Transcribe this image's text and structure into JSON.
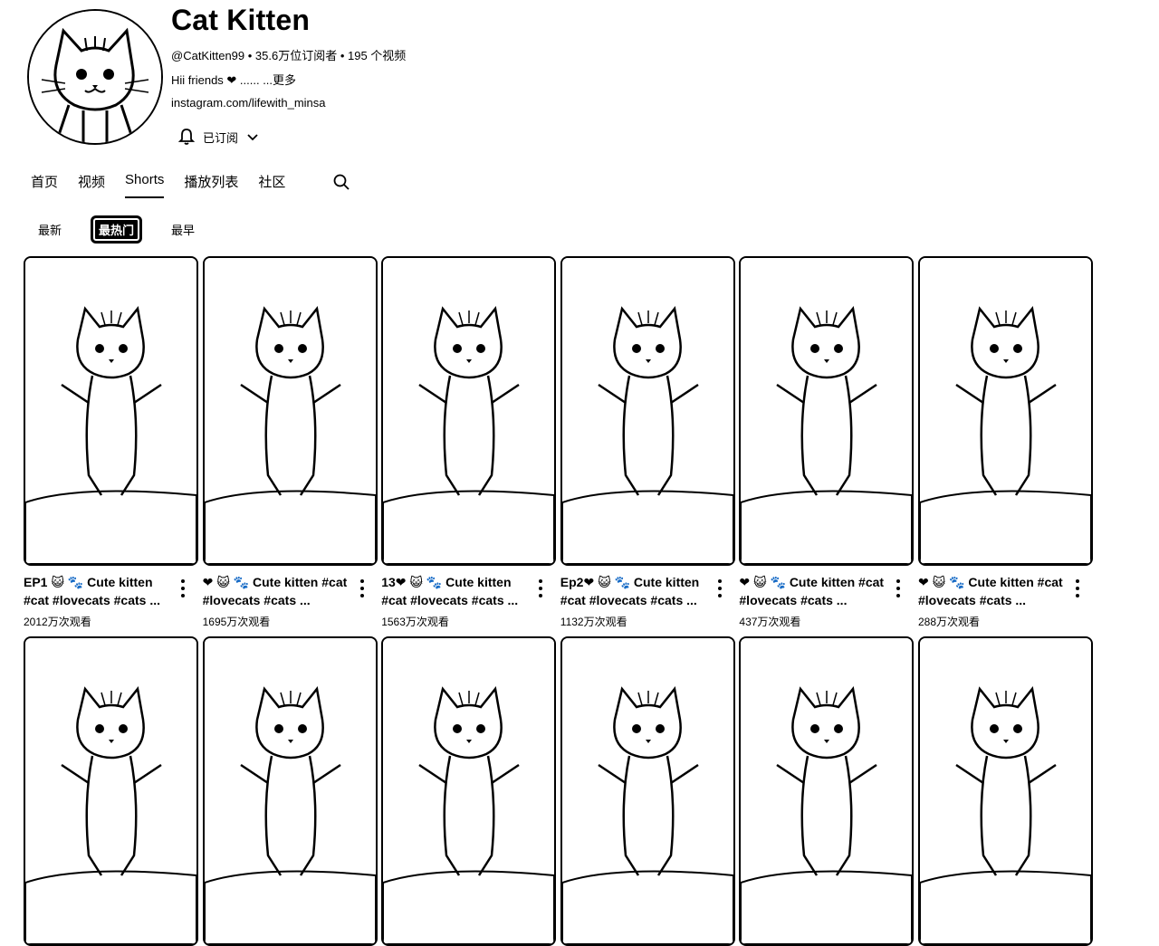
{
  "channel": {
    "name": "Cat Kitten",
    "handle": "@CatKitten99",
    "meta": "@CatKitten99 • 35.6万位订阅者 • 195 个视频",
    "description": "Hii friends ❤ ...... ...更多",
    "link": "instagram.com/lifewith_minsa",
    "subscribe_label": "已订阅",
    "avatar_icon": "cat-avatar-icon"
  },
  "tabs": [
    {
      "label": "首页",
      "active": false
    },
    {
      "label": "视频",
      "active": false
    },
    {
      "label": "Shorts",
      "active": true
    },
    {
      "label": "播放列表",
      "active": false
    },
    {
      "label": "社区",
      "active": false
    }
  ],
  "filters": [
    {
      "label": "最新",
      "active": false
    },
    {
      "label": "最热门",
      "active": true
    },
    {
      "label": "最早",
      "active": false
    }
  ],
  "shorts": [
    {
      "title_line1": "EP1 😺 🐾 Cute kitten",
      "title_line2": "#cat #lovecats #cats ...",
      "views": "2012万次观看"
    },
    {
      "title_line1": "❤ 😺 🐾 Cute kitten #cat",
      "title_line2": "#lovecats #cats ...",
      "views": "1695万次观看"
    },
    {
      "title_line1": "13❤ 😺 🐾 Cute kitten",
      "title_line2": "#cat #lovecats #cats ...",
      "views": "1563万次观看"
    },
    {
      "title_line1": "Ep2❤ 😺 🐾 Cute kitten",
      "title_line2": "#cat #lovecats #cats ...",
      "views": "1132万次观看"
    },
    {
      "title_line1": "❤ 😺 🐾 Cute kitten #cat",
      "title_line2": "#lovecats #cats ...",
      "views": "437万次观看"
    },
    {
      "title_line1": "❤ 😺 🐾 Cute kitten #cat",
      "title_line2": "#lovecats #cats ...",
      "views": "288万次观看"
    },
    {
      "title_line1": "",
      "title_line2": "",
      "views": ""
    },
    {
      "title_line1": "",
      "title_line2": "",
      "views": ""
    },
    {
      "title_line1": "",
      "title_line2": "",
      "views": ""
    },
    {
      "title_line1": "",
      "title_line2": "",
      "views": ""
    },
    {
      "title_line1": "",
      "title_line2": "",
      "views": ""
    },
    {
      "title_line1": "",
      "title_line2": "",
      "views": ""
    }
  ],
  "icons": {
    "bell": "bell-icon",
    "chevron": "chevron-down-icon",
    "search": "search-icon",
    "more": "more-vert-icon"
  }
}
